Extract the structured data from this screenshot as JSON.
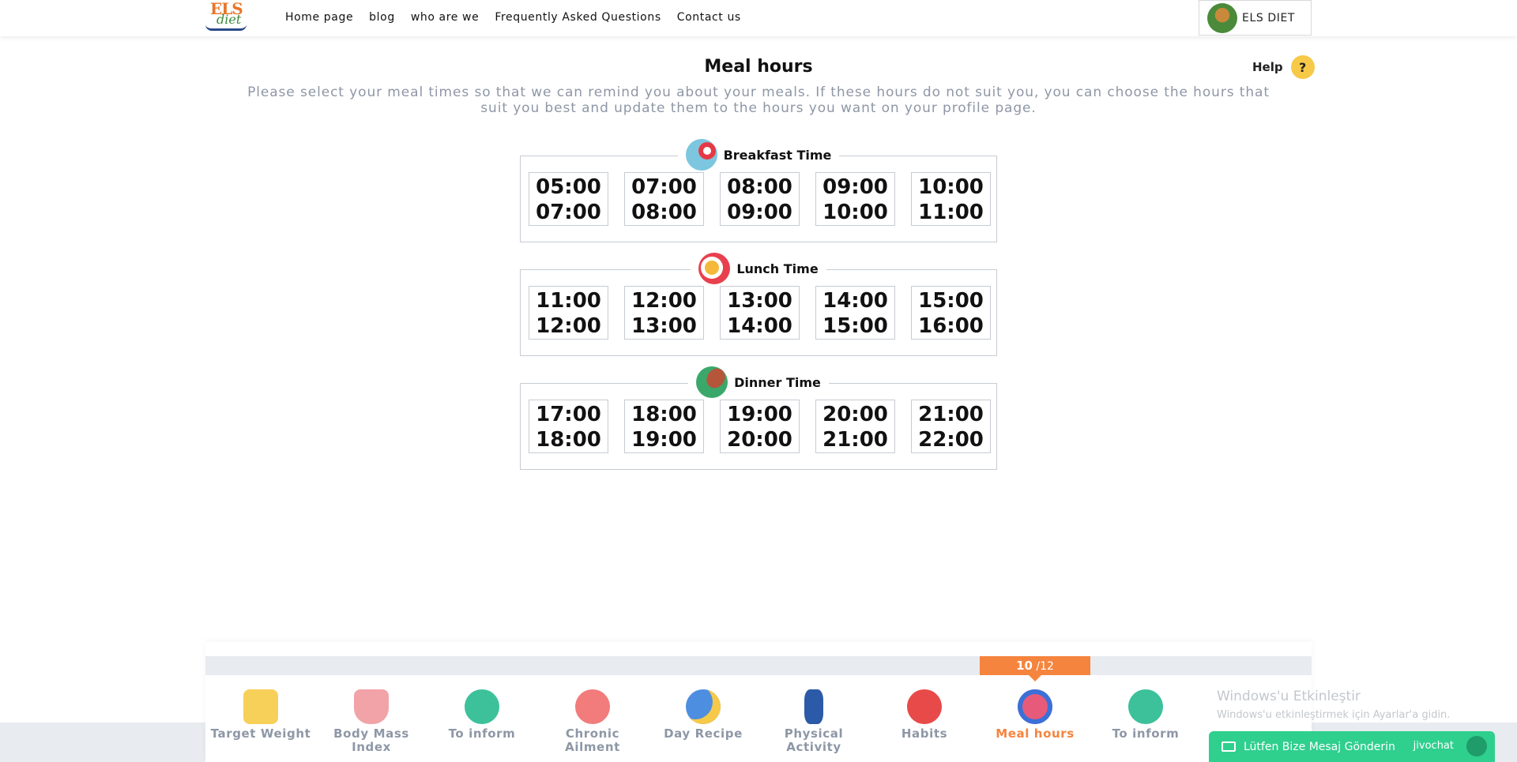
{
  "header": {
    "logo_text": "ELS",
    "logo_sub": "diet",
    "nav": [
      "Home page",
      "blog",
      "who are we",
      "Frequently Asked Questions",
      "Contact us"
    ],
    "user_name": "ELS DIET"
  },
  "main": {
    "title": "Meal hours",
    "help_label": "Help",
    "help_icon": "?",
    "subtitle": "Please select your meal times so that we can remind you about your meals. If these hours do not suit you, you can choose the hours that suit you best and update them to the hours you want on your profile page.",
    "groups": [
      {
        "label": "Breakfast Time",
        "icon": "fried-egg-icon",
        "slots": [
          [
            "05:00",
            "07:00"
          ],
          [
            "07:00",
            "08:00"
          ],
          [
            "08:00",
            "09:00"
          ],
          [
            "09:00",
            "10:00"
          ],
          [
            "10:00",
            "11:00"
          ]
        ]
      },
      {
        "label": "Lunch Time",
        "icon": "soup-bowl-icon",
        "slots": [
          [
            "11:00",
            "12:00"
          ],
          [
            "12:00",
            "13:00"
          ],
          [
            "13:00",
            "14:00"
          ],
          [
            "14:00",
            "15:00"
          ],
          [
            "15:00",
            "16:00"
          ]
        ]
      },
      {
        "label": "Dinner Time",
        "icon": "drumstick-icon",
        "slots": [
          [
            "17:00",
            "18:00"
          ],
          [
            "18:00",
            "19:00"
          ],
          [
            "19:00",
            "20:00"
          ],
          [
            "20:00",
            "21:00"
          ],
          [
            "21:00",
            "22:00"
          ]
        ]
      }
    ]
  },
  "progress": {
    "current": "10",
    "total": "/12",
    "fraction": 0.8333,
    "steps": [
      {
        "label": "Target Weight",
        "icon": "scale-icon"
      },
      {
        "label": "Body Mass Index",
        "icon": "body-icon"
      },
      {
        "label": "To inform",
        "icon": "info-icon"
      },
      {
        "label": "Chronic Ailment",
        "icon": "heart-hand-icon"
      },
      {
        "label": "Day Recipe",
        "icon": "sun-moon-icon"
      },
      {
        "label": "Physical Activity",
        "icon": "exercise-icon"
      },
      {
        "label": "Habits",
        "icon": "faces-icon"
      },
      {
        "label": "Meal hours",
        "icon": "clock-icon"
      },
      {
        "label": "To inform",
        "icon": "info-icon"
      }
    ],
    "active_index": 7
  },
  "overlay": {
    "windows_title": "Windows'u Etkinleştir",
    "windows_sub": "Windows'u etkinleştirmek için Ayarlar'a gidin.",
    "chat_label": "Lütfen Bize Mesaj Gönderin",
    "chat_brand": "jivochat"
  },
  "colors": {
    "accent": "#f5843e",
    "muted": "#8e97a6",
    "border": "#c6ccd3",
    "chat": "#2fcf8e",
    "help": "#f7c948"
  }
}
